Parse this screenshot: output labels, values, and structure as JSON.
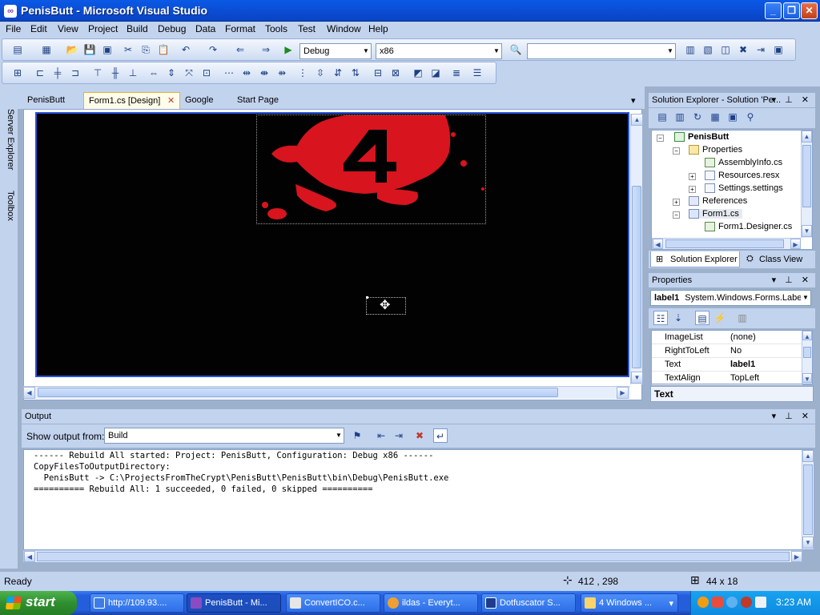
{
  "window": {
    "title": "PenisButt - Microsoft Visual Studio"
  },
  "menu": [
    "File",
    "Edit",
    "View",
    "Project",
    "Build",
    "Debug",
    "Data",
    "Format",
    "Tools",
    "Test",
    "Window",
    "Help"
  ],
  "toolbar": {
    "configuration": "Debug",
    "platform": "x86",
    "find": ""
  },
  "sidebar": {
    "server_explorer": "Server Explorer",
    "toolbox": "Toolbox"
  },
  "doc_tabs": [
    "PenisButt",
    "Form1.cs [Design]",
    "Google",
    "Start Page"
  ],
  "solution_explorer": {
    "title": "Solution Explorer - Solution 'Pe...",
    "tree": {
      "project": "PenisButt",
      "properties": "Properties",
      "assembly_info": "AssemblyInfo.cs",
      "resources": "Resources.resx",
      "settings": "Settings.settings",
      "references": "References",
      "form": "Form1.cs",
      "form_designer": "Form1.Designer.cs"
    },
    "tabs": {
      "solution": "Solution Explorer",
      "class_view": "Class View"
    }
  },
  "properties": {
    "title": "Properties",
    "object_name": "label1",
    "object_type": "System.Windows.Forms.Label",
    "rows": [
      {
        "name": "ImageList",
        "value": "(none)"
      },
      {
        "name": "RightToLeft",
        "value": "No"
      },
      {
        "name": "Text",
        "value": "label1"
      },
      {
        "name": "TextAlign",
        "value": "TopLeft"
      }
    ],
    "description": "Text"
  },
  "output": {
    "title": "Output",
    "show_from_label": "Show output from:",
    "source": "Build",
    "lines": [
      "------ Rebuild All started: Project: PenisButt, Configuration: Debug x86 ------",
      "CopyFilesToOutputDirectory:",
      "  PenisButt -> C:\\ProjectsFromTheCrypt\\PenisButt\\PenisButt\\bin\\Debug\\PenisButt.exe",
      "========== Rebuild All: 1 succeeded, 0 failed, 0 skipped =========="
    ]
  },
  "status": {
    "text": "Ready",
    "position": "412 , 298",
    "size": "44 x 18"
  },
  "taskbar": {
    "start": "start",
    "items": [
      "http://109.93....",
      "PenisButt - Mi...",
      "ConvertICO.c...",
      "ildas - Everyt...",
      "Dotfuscator S...",
      "4 Windows ..."
    ],
    "clock": "3:23 AM"
  },
  "colors": {
    "accent": "#0a5ae6",
    "blood": "#d8141e",
    "canvas": "#020202"
  }
}
